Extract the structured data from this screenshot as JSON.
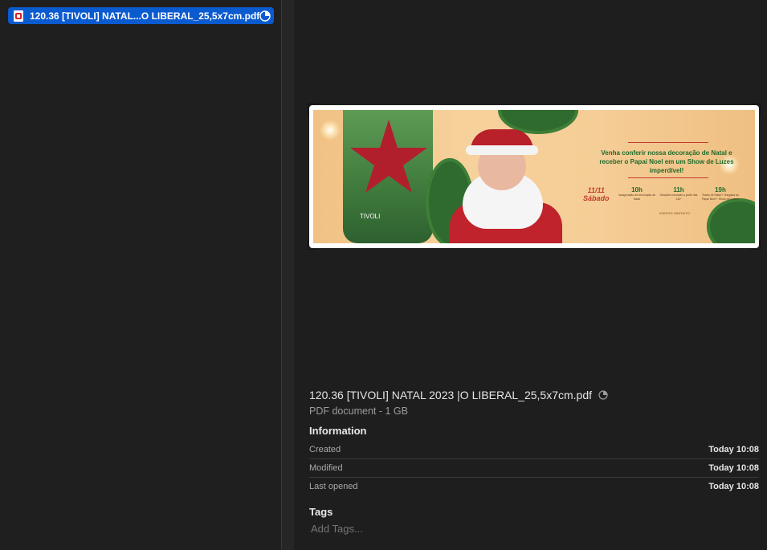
{
  "file_list": {
    "selected_file": "120.36 [TIVOLI] NATAL...O LIBERAL_25,5x7cm.pdf"
  },
  "preview": {
    "title": "120.36 [TIVOLI] NATAL 2023 |O LIBERAL_25,5x7cm.pdf",
    "subtitle": "PDF document - 1 GB",
    "banner": {
      "headline": "Venha conferir nossa decoração de Natal e receber o Papai Noel em um Show de Luzes imperdível!",
      "date": "11/11",
      "weekday": "Sábado",
      "schedule": [
        {
          "time": "10h",
          "desc": "Inauguração da decoração de Natal"
        },
        {
          "time": "11h",
          "desc": "Atrações musicais a partir das 11h*"
        },
        {
          "time": "19h",
          "desc": "Teatro de Natal + chegada do Papai Noel + Show de Luzes*"
        }
      ],
      "free_note": "EVENTO GRATUITO",
      "brand": "TIVOLI"
    }
  },
  "information": {
    "heading": "Information",
    "rows": [
      {
        "label": "Created",
        "value": "Today 10:08"
      },
      {
        "label": "Modified",
        "value": "Today 10:08"
      },
      {
        "label": "Last opened",
        "value": "Today 10:08"
      }
    ]
  },
  "tags": {
    "heading": "Tags",
    "placeholder": "Add Tags..."
  },
  "colors": {
    "selection": "#0a5ad0",
    "background": "#1e1e1e"
  }
}
